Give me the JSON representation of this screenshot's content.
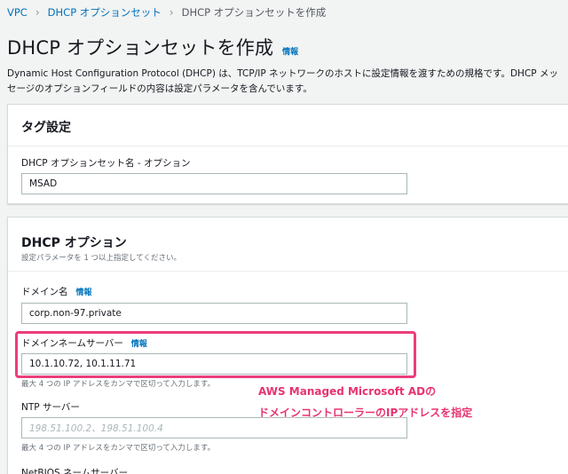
{
  "breadcrumb": {
    "items": [
      "VPC",
      "DHCP オプションセット",
      "DHCP オプションセットを作成"
    ]
  },
  "header": {
    "title": "DHCP オプションセットを作成",
    "info_label": "情報"
  },
  "description": "Dynamic Host Configuration Protocol (DHCP) は、TCP/IP ネットワークのホストに設定情報を渡すための規格です。DHCP メッセージのオプションフィールドの内容は設定パラメータを含んでいます。",
  "tag_section": {
    "title": "タグ設定",
    "name_label": "DHCP オプションセット名 - オプション",
    "name_value": "MSAD"
  },
  "dhcp_section": {
    "title": "DHCP オプション",
    "subtitle": "設定パラメータを 1 つ以上指定してください。",
    "domain_name": {
      "label": "ドメイン名",
      "info_label": "情報",
      "value": "corp.non-97.private"
    },
    "dns_servers": {
      "label": "ドメインネームサーバー",
      "info_label": "情報",
      "value": "10.1.10.72, 10.1.11.71",
      "hint": "最大 4 つの IP アドレスをカンマで区切って入力します。"
    },
    "ntp_servers": {
      "label": "NTP サーバー",
      "placeholder": "198.51.100.2、198.51.100.4",
      "hint": "最大 4 つの IP アドレスをカンマで区切って入力します。"
    },
    "netbios_label": "NetBIOS ネームサーバー"
  },
  "annotation": {
    "line1": "AWS Managed Microsoft ADの",
    "line2": "ドメインコントローラーのIPアドレスを指定",
    "color": "#e8336f"
  },
  "colors": {
    "link": "#0073bb",
    "highlight": "#ec3d7c"
  }
}
